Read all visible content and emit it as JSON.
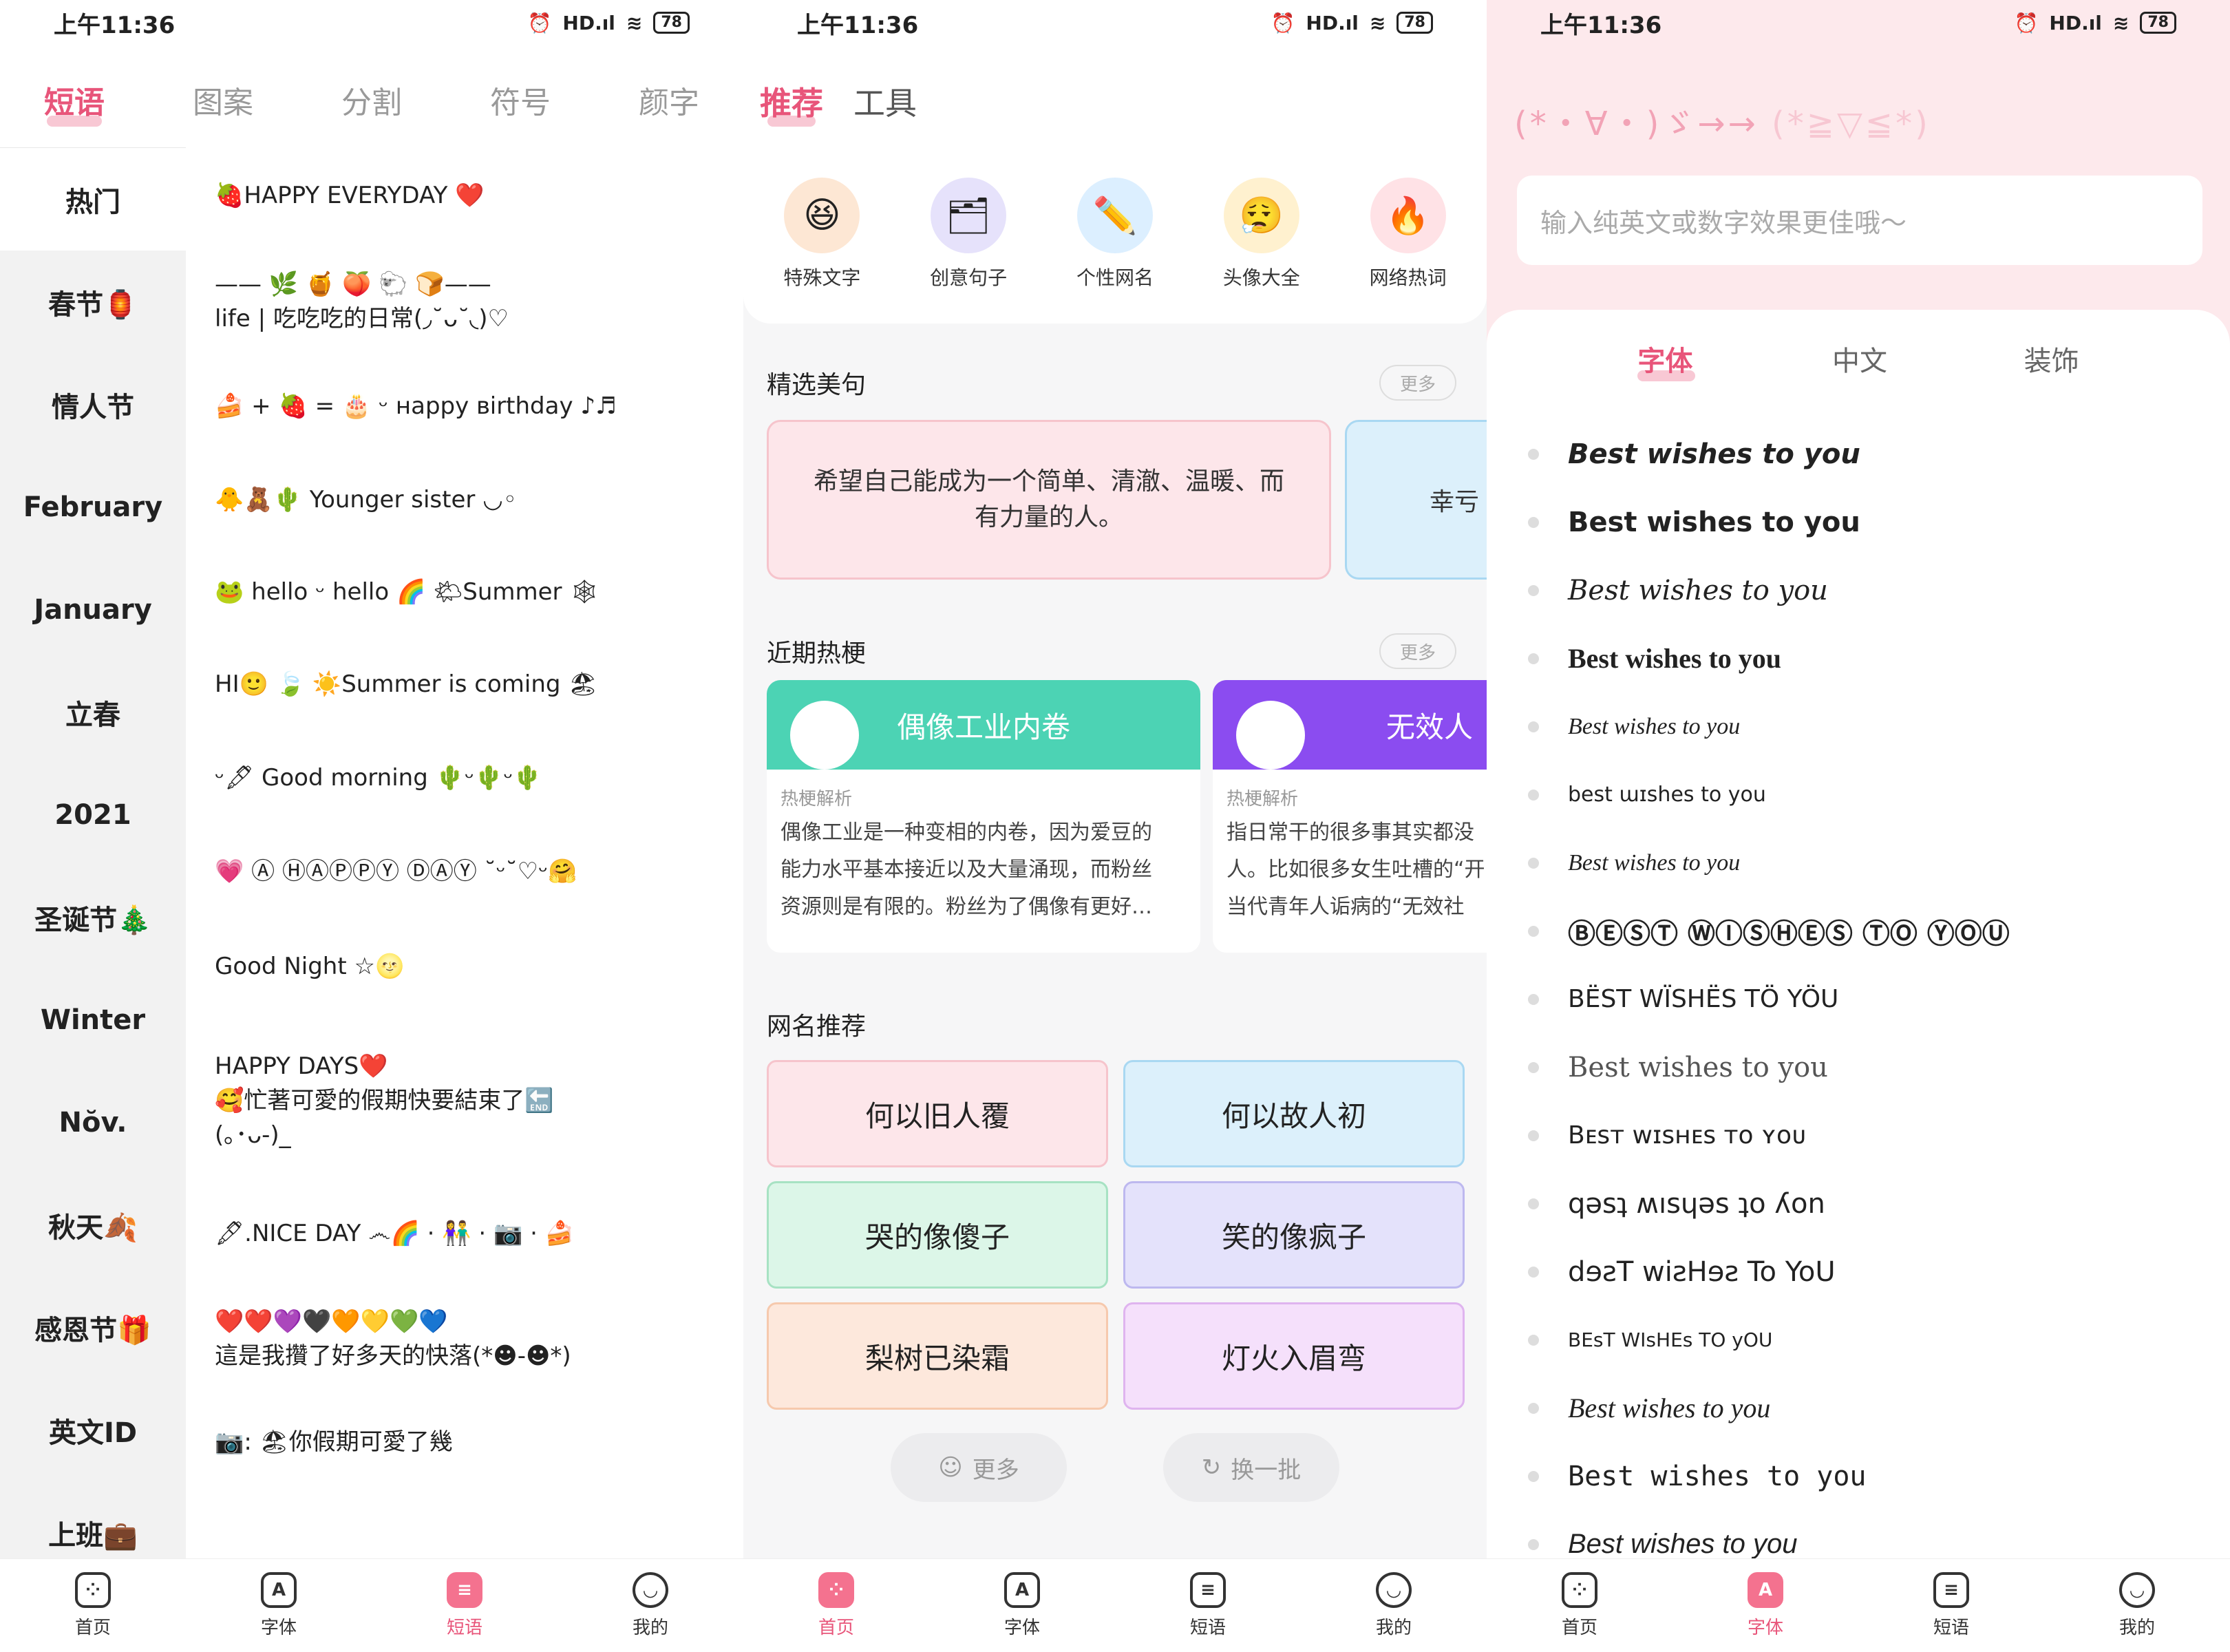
{
  "status": {
    "time": "上午11:36",
    "signal": "HD.ıl",
    "wifi": "≋",
    "alarm": "⏰",
    "battery": "78"
  },
  "panel1": {
    "tabs": [
      "短语",
      "图案",
      "分割",
      "符号",
      "颜字"
    ],
    "sidebar": [
      "热门",
      "春节🏮",
      "情人节",
      "February",
      "January",
      "立春",
      "2021",
      "圣诞节🎄",
      "Winter",
      "Nŏv.",
      "秋天🍂",
      "感恩节🎁",
      "英文ID",
      "上班💼"
    ],
    "phrases": [
      "🍓HAPPY EVERYDAY ❤️",
      "—— 🌿 🍯 🍑 🐑 🍞——\nlife | 吃吃吃的日常(◞˘ᴗ˘◟)♡",
      "🍰 + 🍓 = 🎂 ᵕ ʜappy ʙirthday ♪♬",
      "🐥🧸🌵 Younger sister ◡◦",
      "🐸 hello ᵕ hello 🌈      🌤Summer 🕸",
      "HI🙂 🍃 ☀️Summer is coming 🏖",
      "ᵕ🖋 Good morning 🌵ᵕ🌵ᵕ🌵",
      "💗 Ⓐ ⒽⒶⓅⓅⓎ ⒹⒶⓎ ˘ᵕ˘♡ᵕ🤗",
      "Good Night ☆🌝",
      "HAPPY DAYS❤️\n🥰忙著可愛的假期快要結束了🔚\n(｡･ᴗ-)_",
      "🖋.NICE DAY ෴🌈 · 👫 · 📷 · 🍰",
      "❤️❤️💜🖤🧡💛💚💙\n這是我攢了好多天的快落(*☻-☻*)",
      "📷:                    🏖你假期可愛了幾"
    ]
  },
  "panel2": {
    "tabs": [
      "推荐",
      "工具"
    ],
    "shortcuts": [
      {
        "label": "特殊文字",
        "icon": "😆",
        "color": "#fde7d4"
      },
      {
        "label": "创意句子",
        "icon": "🗂",
        "color": "#e6e2fb"
      },
      {
        "label": "个性网名",
        "icon": "✏️",
        "color": "#dcefff"
      },
      {
        "label": "头像大全",
        "icon": "😮‍💨",
        "color": "#fff1cf"
      },
      {
        "label": "网络热词",
        "icon": "🔥",
        "color": "#ffe2e6"
      }
    ],
    "section_quotes": "精选美句",
    "more": "更多",
    "quote_main": "希望自己能成为一个简单、清澈、温暖、而有力量的人。",
    "quote_side": "幸亏",
    "section_memes": "近期热梗",
    "memes": [
      {
        "title": "偶像工业内卷",
        "tag": "热梗解析",
        "desc": "偶像工业是一种变相的内卷，因为爱豆的\n能力水平基本接近以及大量涌现，而粉丝\n资源则是有限的。粉丝为了偶像有更好…",
        "color": "#4cd3b4"
      },
      {
        "title": "无效人",
        "tag": "热梗解析",
        "desc": "指日常干的很多事其实都没\n人。比如很多女生吐槽的“开\n当代青年人诟病的“无效社",
        "color": "#8b4cf0"
      }
    ],
    "section_names": "网名推荐",
    "names": [
      {
        "text": "何以旧人覆",
        "bg": "#fde6ea",
        "border": "#f6c4cc"
      },
      {
        "text": "何以故人初",
        "bg": "#dcf0fb",
        "border": "#a9d8f2"
      },
      {
        "text": "哭的像傻子",
        "bg": "#dcf6e8",
        "border": "#a7e2c3"
      },
      {
        "text": "笑的像疯子",
        "bg": "#e4e2fb",
        "border": "#bdb8ef"
      },
      {
        "text": "梨树已染霜",
        "bg": "#fde8dc",
        "border": "#f6c9ad"
      },
      {
        "text": "灯火入眉弯",
        "bg": "#f5e0fb",
        "border": "#dfb4ef"
      }
    ],
    "btn_more": "更多",
    "btn_refresh": "换一批"
  },
  "panel3": {
    "kaomoji": "(*・∀・)ゞ→→",
    "kaomoji_faint": "(*≧▽≦*)",
    "placeholder": "输入纯英文或数字效果更佳哦～",
    "tabs": [
      "字体",
      "中文",
      "装饰"
    ],
    "fonts": [
      "Best wishes to you",
      "Best wishes to you",
      "Best wishes to you",
      "Best wishes to you",
      "Best wishes to you",
      "best ɯɪshes to you",
      "Best wishes to you",
      "ⒷⒺⓈⓉ ⓌⒾⓈⒽⒺⓈ ⓉⓄ ⓎⓄⓊ",
      "BËST WÏSHËS TÖ YÖU",
      "Best wishes to you",
      "Bᴇsᴛ ᴡɪsʜᴇs ᴛᴏ ʏᴏᴜ",
      "qəsʇ ʍısɥəs ʇo ʎon",
      "dɘƨT wiƨHɘƨ To YoU",
      "BEsT WIsHEs TO yOU",
      "Best wishes to you",
      "Best wishes to you",
      "Best wishes to you"
    ]
  },
  "nav": {
    "p1": [
      "首页",
      "字体",
      "短语",
      "我的"
    ],
    "p2": [
      "首页",
      "字体",
      "短语",
      "我的"
    ],
    "p3": [
      "首页",
      "字体",
      "短语",
      "我的"
    ]
  },
  "accent": "#e8557a"
}
